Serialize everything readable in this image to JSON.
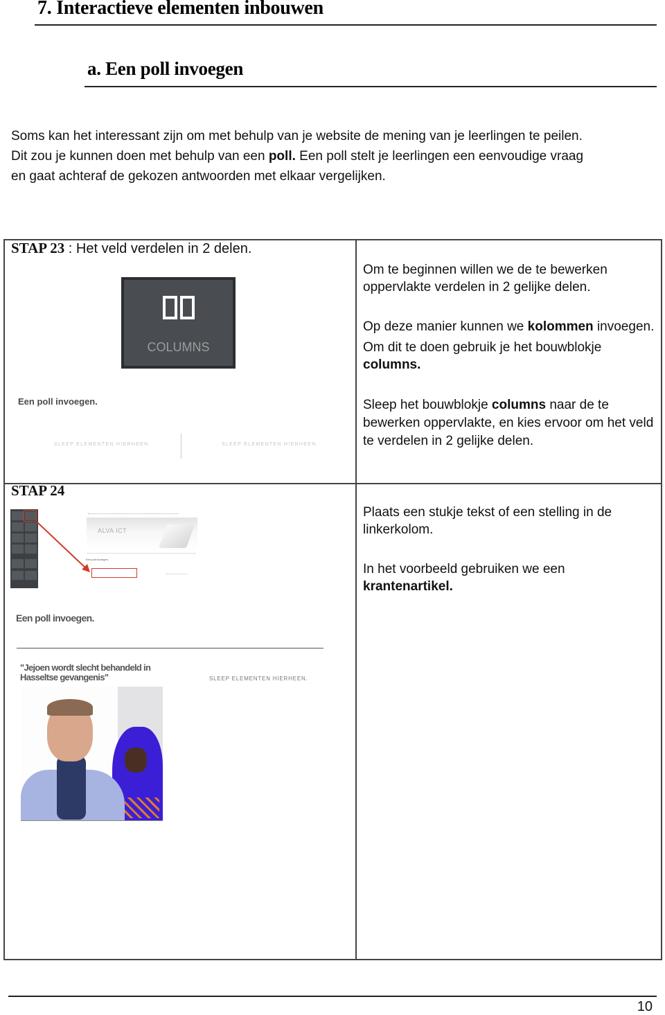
{
  "heading": "7. Interactieve elementen inbouwen",
  "subheading": "a. Een poll invoegen",
  "intro": {
    "line1": "Soms kan het interessant zijn om met behulp van je website de mening van je leerlingen te peilen.",
    "line2_pre": "Dit zou je kunnen doen met behulp van een ",
    "line2_bold": "poll.",
    "line2_post": " Een poll stelt je leerlingen een eenvoudige vraag",
    "line3": "en gaat achteraf de gekozen antwoorden met elkaar vergelijken."
  },
  "steps": [
    {
      "num": "STAP 23",
      "title": " : Het veld verdelen in 2 delen.",
      "widget": {
        "icon": "columns-icon",
        "label": "COLUMNS"
      },
      "preview": {
        "page_title": "Een poll invoegen.",
        "drop_left": "SLEEP ELEMENTEN HIERHEEN.",
        "drop_right": "SLEEP ELEMENTEN HIERHEEN."
      },
      "text": {
        "p1": "Om te beginnen willen we de te bewerken oppervlakte verdelen in 2 gelijke delen.",
        "p2_pre": "Op deze manier kunnen we ",
        "p2_bold": "kolommen",
        "p2_post": " invoegen.",
        "p3_pre": "Om dit te doen gebruik je het bouwblokje ",
        "p3_bold": "columns.",
        "p4_pre": "Sleep het bouwblokje ",
        "p4_bold": "columns",
        "p4_post": " naar de te bewerken oppervlakte, en kies ervoor om het veld te verdelen in 2 gelijke delen."
      }
    },
    {
      "num": "STAP 24",
      "screenshot": {
        "site_brand": "ALVA ICT",
        "page_title": "Een poll invoegen."
      },
      "preview": {
        "page_title": "Een poll invoegen.",
        "article_title": "\"Jejoen wordt slecht behandeld in Hasseltse gevangenis\"",
        "drop_right": "SLEEP ELEMENTEN HIERHEEN."
      },
      "text": {
        "p1": "Plaats een stukje tekst of een stelling in de linkerkolom.",
        "p2_pre": "In het voorbeeld gebruiken we een ",
        "p2_bold": "krantenartikel."
      }
    }
  ],
  "page_number": "10",
  "colors": {
    "highlight": "#d23a2a",
    "widget_bg": "#494c51"
  }
}
